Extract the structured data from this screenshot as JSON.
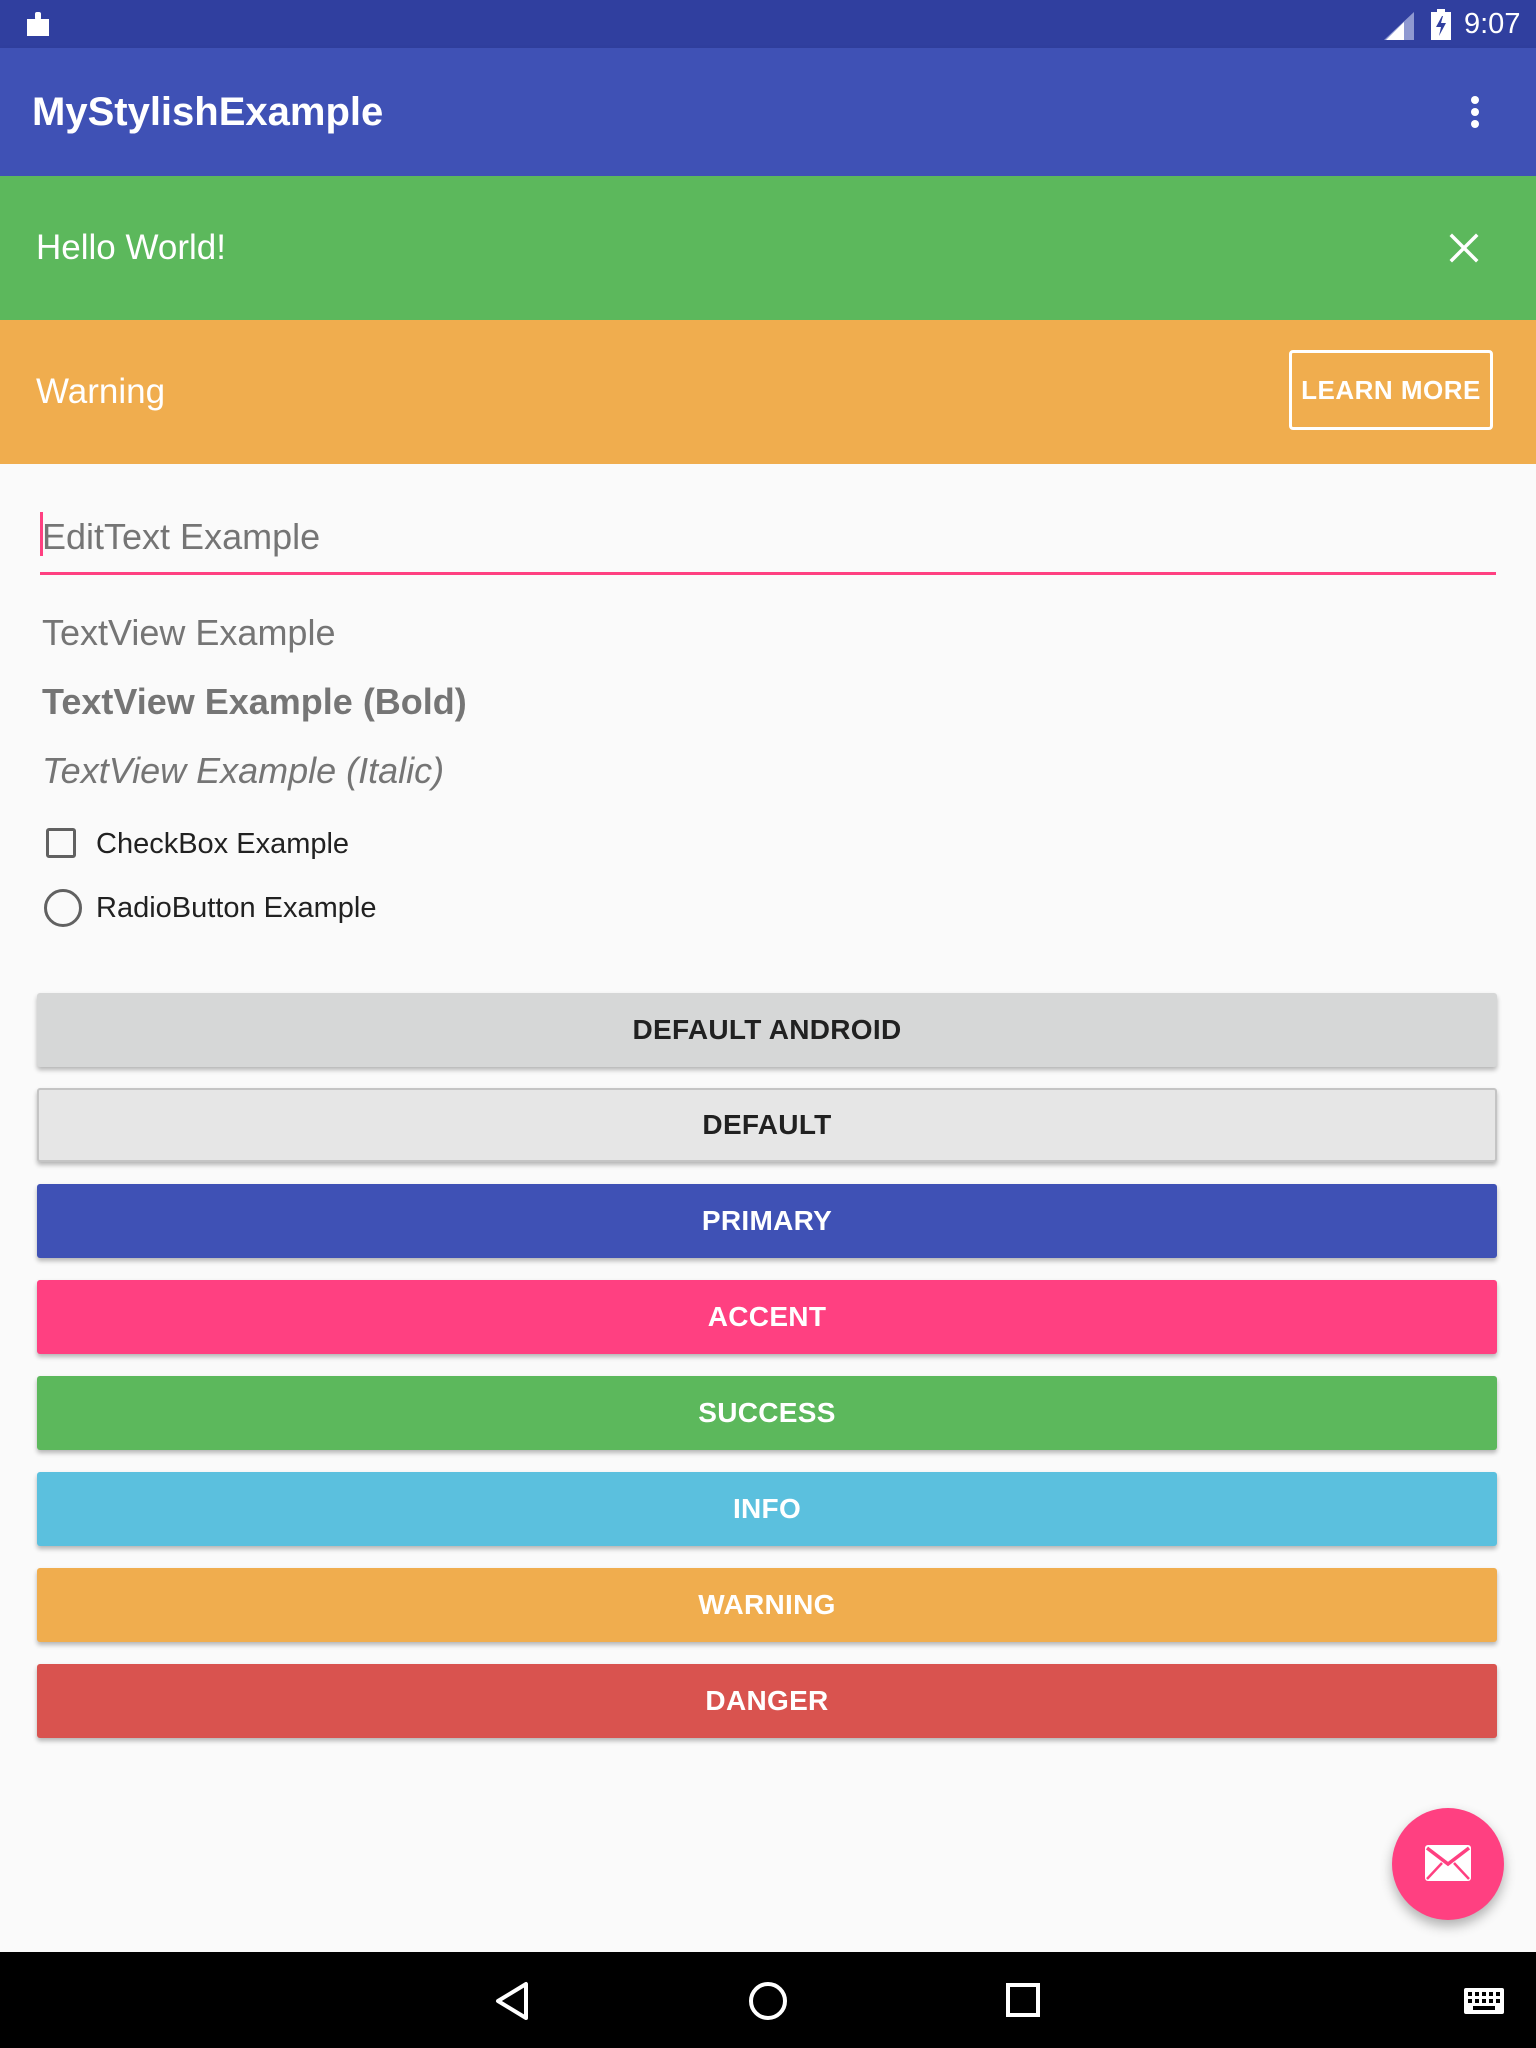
{
  "status_bar": {
    "time": "9:07",
    "icons": [
      "notification-puzzle-icon",
      "signal-icon",
      "battery-charging-icon"
    ],
    "color": "#303f9f"
  },
  "app_bar": {
    "title": "MyStylishExample",
    "overflow_icon": "more-vert-icon",
    "color": "#3f51b5"
  },
  "banners": {
    "success": {
      "text": "Hello World!",
      "close_icon": "close-icon",
      "color": "#5cb85c"
    },
    "warning": {
      "text": "Warning",
      "action_label": "LEARN MORE",
      "color": "#f0ad4e"
    }
  },
  "form": {
    "edittext": {
      "placeholder": "EditText Example",
      "accent": "#ff4081"
    },
    "textview_regular": "TextView Example",
    "textview_bold": "TextView Example (Bold)",
    "textview_italic": "TextView Example (Italic)",
    "checkbox": {
      "label": "CheckBox Example",
      "checked": false
    },
    "radio": {
      "label": "RadioButton Example",
      "selected": false
    }
  },
  "buttons": [
    {
      "label": "DEFAULT ANDROID",
      "color": "#d6d7d7"
    },
    {
      "label": "DEFAULT",
      "color": "#e6e6e6"
    },
    {
      "label": "PRIMARY",
      "color": "#3f51b5"
    },
    {
      "label": "ACCENT",
      "color": "#ff4081"
    },
    {
      "label": "SUCCESS",
      "color": "#5cb85c"
    },
    {
      "label": "INFO",
      "color": "#5bc0de"
    },
    {
      "label": "WARNING",
      "color": "#f0ad4e"
    },
    {
      "label": "DANGER",
      "color": "#d9534f"
    }
  ],
  "fab": {
    "icon": "mail-icon",
    "color": "#ff4081"
  },
  "nav_bar": {
    "icons": [
      "back-icon",
      "home-icon",
      "recents-icon",
      "keyboard-icon"
    ]
  }
}
